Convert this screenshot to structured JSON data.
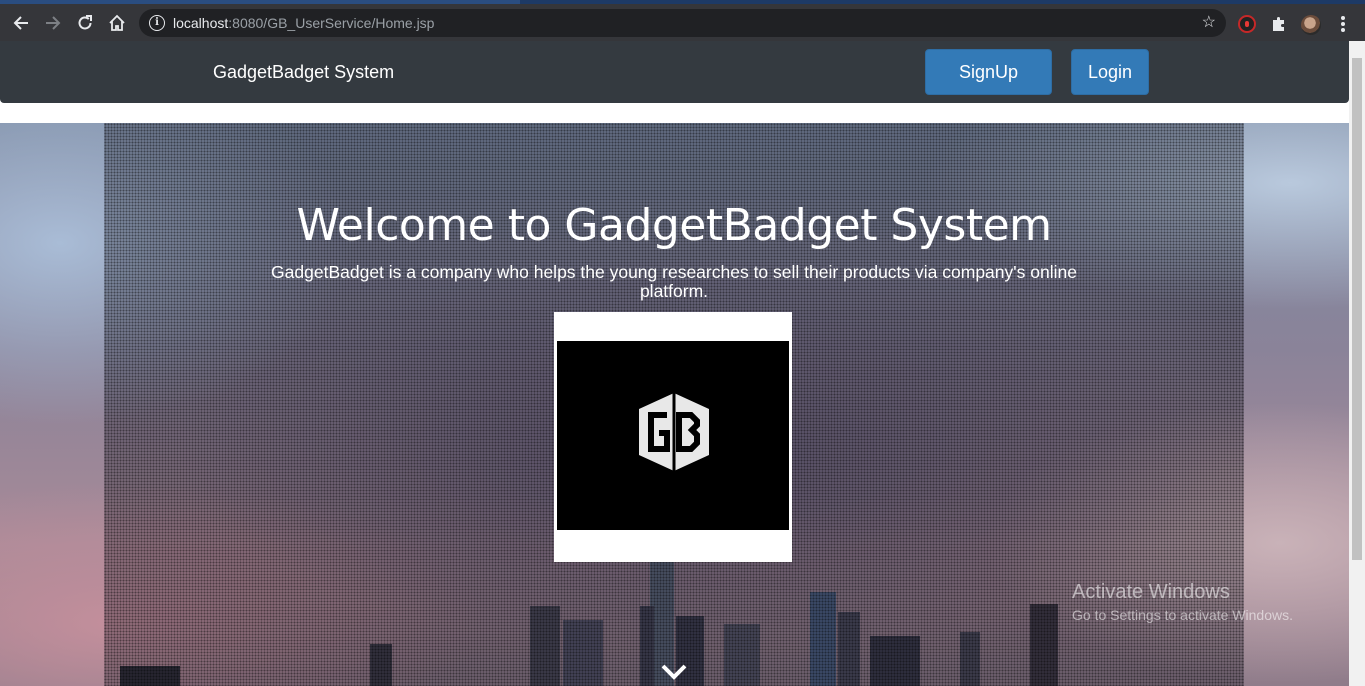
{
  "browser": {
    "url_host": "localhost",
    "url_path": ":8080/GB_UserService/Home.jsp"
  },
  "navbar": {
    "brand": "GadgetBadget System",
    "signup_label": "SignUp",
    "login_label": "Login"
  },
  "hero": {
    "title": "Welcome to GadgetBadget System",
    "subtitle": "GadgetBadget is a company who helps the young researches to sell their products via company's online platform.",
    "logo_text": "GB"
  },
  "watermark": {
    "line1": "Activate Windows",
    "line2": "Go to Settings to activate Windows."
  },
  "colors": {
    "navbar_bg": "#343a40",
    "button_bg": "#337ab7",
    "chrome_bg": "#35363a"
  }
}
